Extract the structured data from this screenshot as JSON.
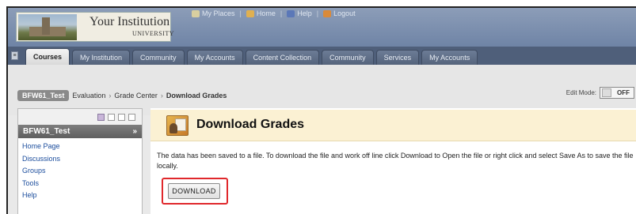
{
  "header": {
    "logo_title": "Your Institution",
    "logo_subtitle": "UNIVERSITY",
    "top_links": [
      {
        "label": "My Places",
        "icon": "people-icon"
      },
      {
        "label": "Home",
        "icon": "home-icon"
      },
      {
        "label": "Help",
        "icon": "help-icon"
      },
      {
        "label": "Logout",
        "icon": "logout-icon"
      }
    ]
  },
  "tabs": [
    "Courses",
    "My Institution",
    "Community",
    "My Accounts",
    "Content Collection",
    "Community",
    "Services",
    "My Accounts"
  ],
  "active_tab": "Courses",
  "breadcrumb": {
    "course": "BFW61_Test",
    "items": [
      "Evaluation",
      "Grade Center",
      "Download Grades"
    ]
  },
  "edit_mode": {
    "label": "Edit Mode:",
    "state": "OFF"
  },
  "course_menu": {
    "title": "BFW61_Test",
    "items": [
      "Home Page",
      "Discussions",
      "Groups",
      "Tools",
      "Help"
    ]
  },
  "page": {
    "title": "Download Grades",
    "message": "The data has been saved to a file. To download the file and work off line click Download to Open the file or right click and select Save As to save the file locally.",
    "download_label": "DOWNLOAD"
  },
  "colors": {
    "header": "#7a8cab",
    "tab_bar": "#4f5f7a",
    "link": "#1a4c9c",
    "page_header_bg": "#fbf1d3",
    "highlight": "#e0282c"
  }
}
